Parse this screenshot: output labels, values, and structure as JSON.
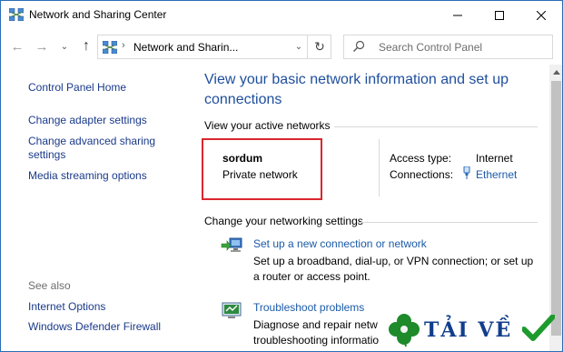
{
  "window": {
    "title": "Network and Sharing Center",
    "controls": {
      "minimize": "—",
      "maximize": "☐",
      "close": "✕"
    }
  },
  "navigation": {
    "back": "←",
    "forward": "→",
    "recent": "⌄",
    "up": "↑",
    "address_separator": "›",
    "address_text": "Network and Sharin...",
    "address_dropdown": "⌄",
    "refresh": "↻",
    "search_placeholder": "Search Control Panel"
  },
  "sidebar": {
    "items": [
      {
        "label": "Control Panel Home"
      },
      {
        "label": "Change adapter settings"
      },
      {
        "label": "Change advanced sharing settings"
      },
      {
        "label": "Media streaming options"
      }
    ],
    "see_also_label": "See also",
    "see_also": [
      {
        "label": "Internet Options"
      },
      {
        "label": "Windows Defender Firewall"
      }
    ]
  },
  "main": {
    "heading": "View your basic network information and set up connections",
    "active_networks_label": "View your active networks",
    "network": {
      "name": "sordum",
      "type": "Private network",
      "access_type_label": "Access type:",
      "access_type_value": "Internet",
      "connections_label": "Connections:",
      "connections_value": "Ethernet"
    },
    "change_settings_label": "Change your networking settings",
    "tasks": [
      {
        "icon": "network-setup-icon",
        "title": "Set up a new connection or network",
        "description": "Set up a broadband, dial-up, or VPN connection; or set up a router or access point."
      },
      {
        "icon": "troubleshoot-icon",
        "title": "Troubleshoot problems",
        "description": "Diagnose and repair netw troubleshooting informatio"
      }
    ]
  },
  "watermark": {
    "text": "TẢI VỀ"
  },
  "colors": {
    "link": "#1a5aa8",
    "heading": "#1e4e9c",
    "highlight_box": "#d9272e",
    "window_border": "#2b6cb8"
  }
}
